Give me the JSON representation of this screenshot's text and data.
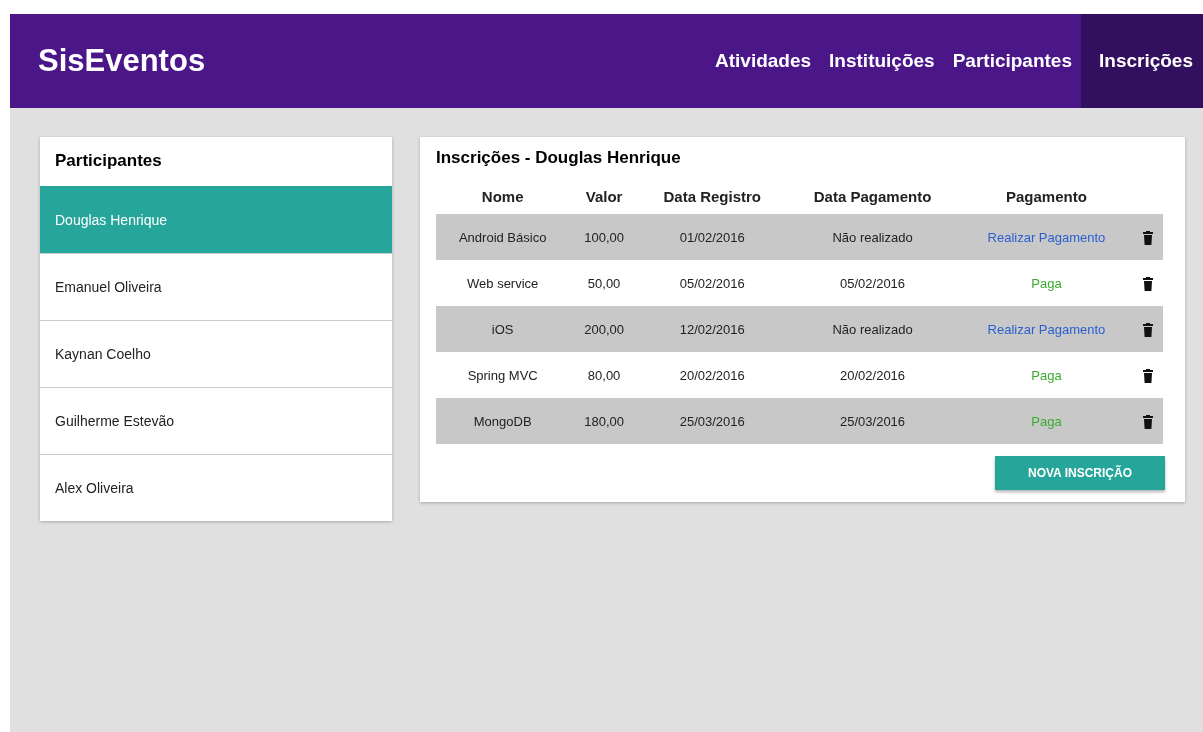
{
  "navbar": {
    "brand": "SisEventos",
    "links": [
      {
        "label": "Atividades",
        "selected": false
      },
      {
        "label": "Instituições",
        "selected": false
      },
      {
        "label": "Participantes",
        "selected": false
      },
      {
        "label": "Inscrições",
        "selected": true
      }
    ]
  },
  "sidebar": {
    "title": "Participantes",
    "items": [
      {
        "label": "Douglas Henrique",
        "selected": true
      },
      {
        "label": "Emanuel Oliveira",
        "selected": false
      },
      {
        "label": "Kaynan Coelho",
        "selected": false
      },
      {
        "label": "Guilherme Estevão",
        "selected": false
      },
      {
        "label": "Alex Oliveira",
        "selected": false
      }
    ]
  },
  "main": {
    "title": "Inscrições - Douglas Henrique",
    "table": {
      "columns": [
        "Nome",
        "Valor",
        "Data Registro",
        "Data Pagamento",
        "Pagamento"
      ],
      "rows": [
        {
          "nome": "Android Básico",
          "valor": "100,00",
          "data_registro": "01/02/2016",
          "data_pagamento": "Não realizado",
          "pagamento": {
            "kind": "link",
            "text": "Realizar Pagamento"
          }
        },
        {
          "nome": "Web service",
          "valor": "50,00",
          "data_registro": "05/02/2016",
          "data_pagamento": "05/02/2016",
          "pagamento": {
            "kind": "status",
            "text": "Paga"
          }
        },
        {
          "nome": "iOS",
          "valor": "200,00",
          "data_registro": "12/02/2016",
          "data_pagamento": "Não realizado",
          "pagamento": {
            "kind": "link",
            "text": "Realizar Pagamento"
          }
        },
        {
          "nome": "Spring MVC",
          "valor": "80,00",
          "data_registro": "20/02/2016",
          "data_pagamento": "20/02/2016",
          "pagamento": {
            "kind": "status",
            "text": "Paga"
          }
        },
        {
          "nome": "MongoDB",
          "valor": "180,00",
          "data_registro": "25/03/2016",
          "data_pagamento": "25/03/2016",
          "pagamento": {
            "kind": "status",
            "text": "Paga"
          }
        }
      ]
    },
    "button": "NOVA INSCRIÇÃO"
  }
}
